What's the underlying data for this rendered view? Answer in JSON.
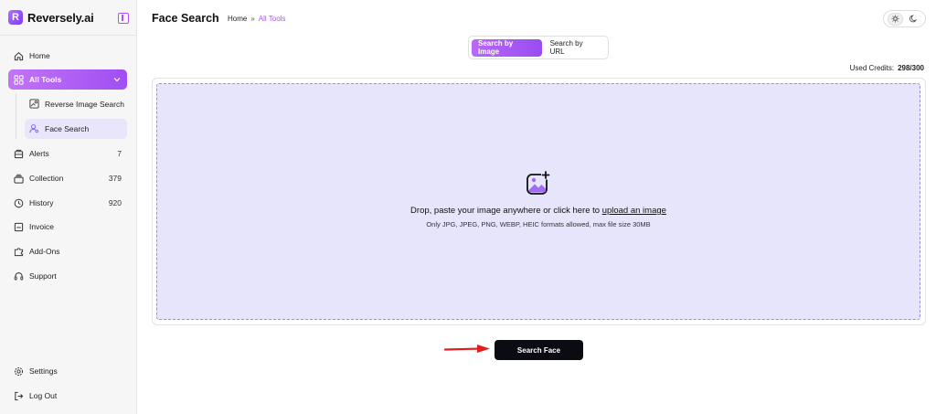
{
  "brand": {
    "name": "Reversely.ai",
    "logo_letter": "R"
  },
  "sidebar": {
    "items": [
      {
        "label": "Home",
        "icon": "home-icon"
      },
      {
        "label": "All Tools",
        "icon": "grid-icon",
        "active": true
      },
      {
        "label": "Alerts",
        "icon": "bell-icon",
        "count": "7"
      },
      {
        "label": "Collection",
        "icon": "stack-icon",
        "count": "379"
      },
      {
        "label": "History",
        "icon": "history-icon",
        "count": "920"
      },
      {
        "label": "Invoice",
        "icon": "invoice-icon"
      },
      {
        "label": "Add-Ons",
        "icon": "puzzle-icon"
      },
      {
        "label": "Support",
        "icon": "support-icon"
      }
    ],
    "sub_items": [
      {
        "label": "Reverse Image Search",
        "icon": "image-search-icon"
      },
      {
        "label": "Face Search",
        "icon": "face-search-icon",
        "active": true
      }
    ],
    "bottom": [
      {
        "label": "Settings",
        "icon": "gear-icon"
      },
      {
        "label": "Log Out",
        "icon": "logout-icon"
      }
    ]
  },
  "header": {
    "title": "Face Search",
    "breadcrumb": {
      "home": "Home",
      "sep": "»",
      "current": "All Tools"
    }
  },
  "tabs": [
    {
      "label": "Search by Image",
      "selected": true
    },
    {
      "label": "Search by URL",
      "selected": false
    }
  ],
  "credits": {
    "label": "Used Credits:",
    "value": "298/300"
  },
  "dropzone": {
    "text": "Drop, paste your image anywhere or click here to",
    "link": "upload an image",
    "hint": "Only JPG, JPEG, PNG, WEBP, HEIC formats allowed, max file size 30MB"
  },
  "search_button": {
    "label": "Search Face"
  },
  "colors": {
    "accent": "#a855f7",
    "dropzone_bg": "#e7e5fb",
    "button_bg": "#0b0b12",
    "arrow": "#e11d1d"
  }
}
